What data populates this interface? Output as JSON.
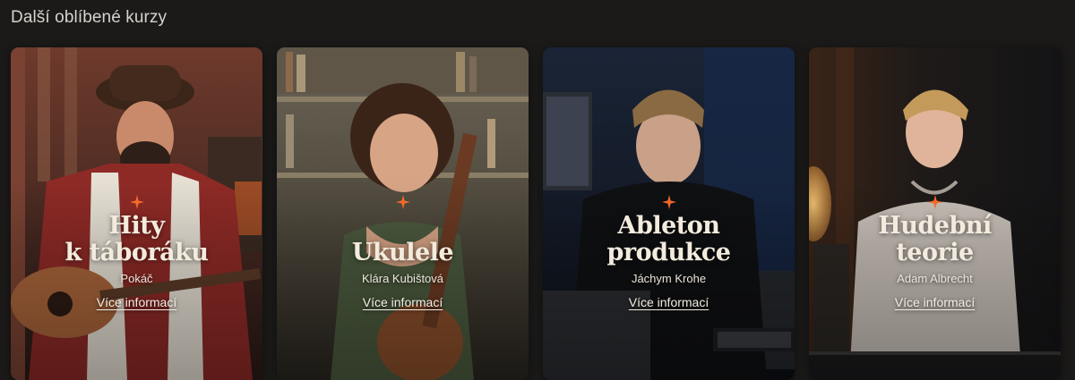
{
  "section": {
    "title": "Další oblíbené kurzy"
  },
  "colors": {
    "accent_star": "#f36a2c",
    "title_text": "#f3ebdd",
    "page_bg": "#1b1a19"
  },
  "cards": [
    {
      "title": "Hity\nk táboráku",
      "teacher": "Pokáč",
      "link": "Více informací"
    },
    {
      "title": "Ukulele",
      "teacher": "Klára Kubištová",
      "link": "Více informací"
    },
    {
      "title": "Ableton\nprodukce",
      "teacher": "Jáchym Krohe",
      "link": "Více informací"
    },
    {
      "title": "Hudební\nteorie",
      "teacher": "Adam Albrecht",
      "link": "Více informací"
    }
  ]
}
